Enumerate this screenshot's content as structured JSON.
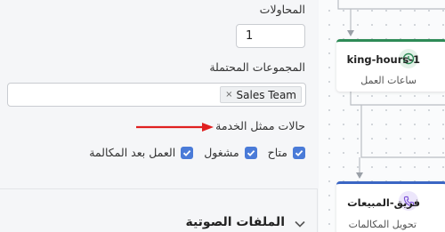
{
  "settings": {
    "attempts_label": "المحاولات",
    "attempts_value": "1",
    "groups_label": "المجموعات المحتملة",
    "groups_tags": [
      {
        "label": "Sales Team",
        "remove": "×"
      }
    ],
    "agent_states_label": "حالات ممثل الخدمة",
    "agent_states": [
      {
        "label": "متاح",
        "checked": true
      },
      {
        "label": "مشغول",
        "checked": true
      },
      {
        "label": "العمل بعد المكالمة",
        "checked": true
      }
    ],
    "voice_files_label": "الملفات الصوتية"
  },
  "canvas": {
    "nodes": [
      {
        "title": "king-hours-1",
        "subtitle": "ساعات العمل",
        "icon": "clock-icon",
        "accent": "#2e8b57"
      },
      {
        "title": "فريق-المبيعات",
        "subtitle": "تحويل المكالمات",
        "icon": "phone-icon",
        "accent": "#3b66c4"
      }
    ]
  },
  "colors": {
    "checkbox": "#4a7bd8",
    "annotation_arrow": "#e02020"
  }
}
